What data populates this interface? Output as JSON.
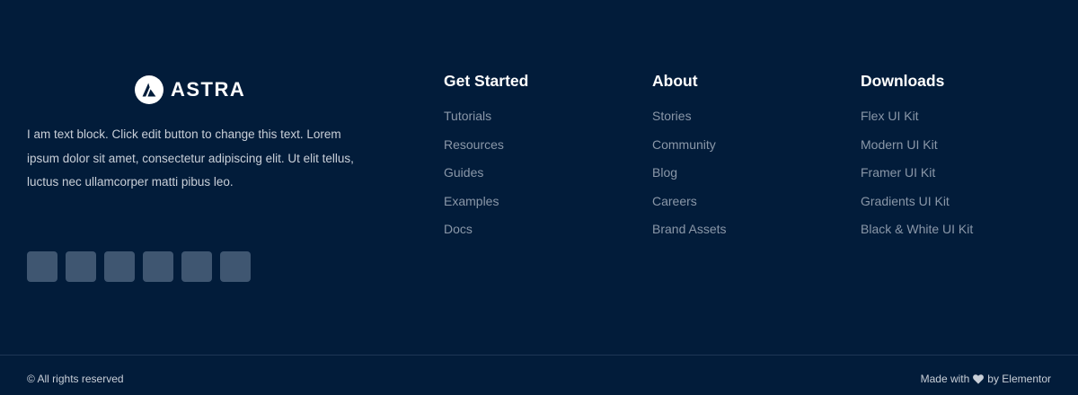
{
  "brand": {
    "logo_text": "ASTRA",
    "logo_icon": "astra-logo-icon",
    "description": "I am text block. Click edit button to change this text. Lorem ipsum dolor sit amet, consectetur adipiscing elit. Ut elit tellus, luctus nec ullamcorper matti pibus leo.",
    "social_icons": [
      "social-icon-1",
      "social-icon-2",
      "social-icon-3",
      "social-icon-4",
      "social-icon-5",
      "social-icon-6"
    ]
  },
  "columns": [
    {
      "title": "Get Started",
      "links": [
        "Tutorials",
        "Resources",
        "Guides",
        "Examples",
        "Docs"
      ]
    },
    {
      "title": "About",
      "links": [
        "Stories",
        "Community",
        "Blog",
        "Careers",
        "Brand Assets"
      ]
    },
    {
      "title": "Downloads",
      "links": [
        "Flex UI Kit",
        "Modern UI Kit",
        "Framer UI Kit",
        "Gradients UI Kit",
        "Black & White UI Kit"
      ]
    }
  ],
  "bottom": {
    "copyright": "© All rights reserved",
    "credit_prefix": "Made with",
    "credit_icon": "heart-icon",
    "credit_suffix": "by Elementor"
  },
  "colors": {
    "background": "#021c3a",
    "heading": "#ffffff",
    "link": "#8a97a8",
    "body_text": "#c9cfd8",
    "social_button": "#3f5671"
  }
}
